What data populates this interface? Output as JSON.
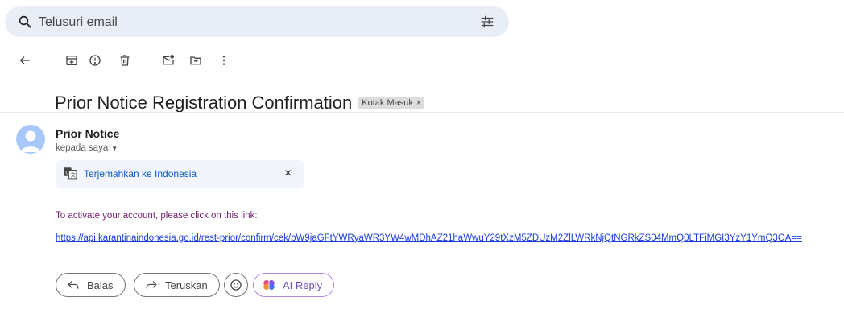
{
  "search": {
    "placeholder": "Telusuri email",
    "search_icon": "search-icon",
    "filter_icon": "tune-icon"
  },
  "toolbar": {
    "icons": [
      "back-arrow-icon",
      "archive-icon",
      "report-spam-icon",
      "delete-icon",
      "mark-unread-icon",
      "move-to-icon",
      "more-vert-icon"
    ]
  },
  "email": {
    "subject": "Prior Notice Registration Confirmation",
    "label": "Kotak Masuk",
    "label_close": "×",
    "sender_name": "Prior Notice",
    "to_text": "kepada saya",
    "translate_text": "Terjemahkan ke Indonesia",
    "translate_close": "×",
    "body_line": "To activate your account, please click on this link:",
    "body_link": "https://api.karantinaindonesia.go.id/rest-prior/confirm/cek/bW9jaGFtYWRyaWR3YW4wMDhAZ21haWwuY29tXzM5ZDUzM2ZlLWRkNjQtNGRkZS04MmQ0LTFiMGI3YzY1YmQ3OA=="
  },
  "actions": {
    "reply": "Balas",
    "forward": "Teruskan",
    "ai_reply": "AI Reply"
  },
  "colors": {
    "search_bg": "#e9eef6",
    "link_blue": "#0b57d0",
    "body_text_purple": "#6f1f6e",
    "body_link": "#1a3ddf",
    "ai_border": "#b58adf"
  }
}
